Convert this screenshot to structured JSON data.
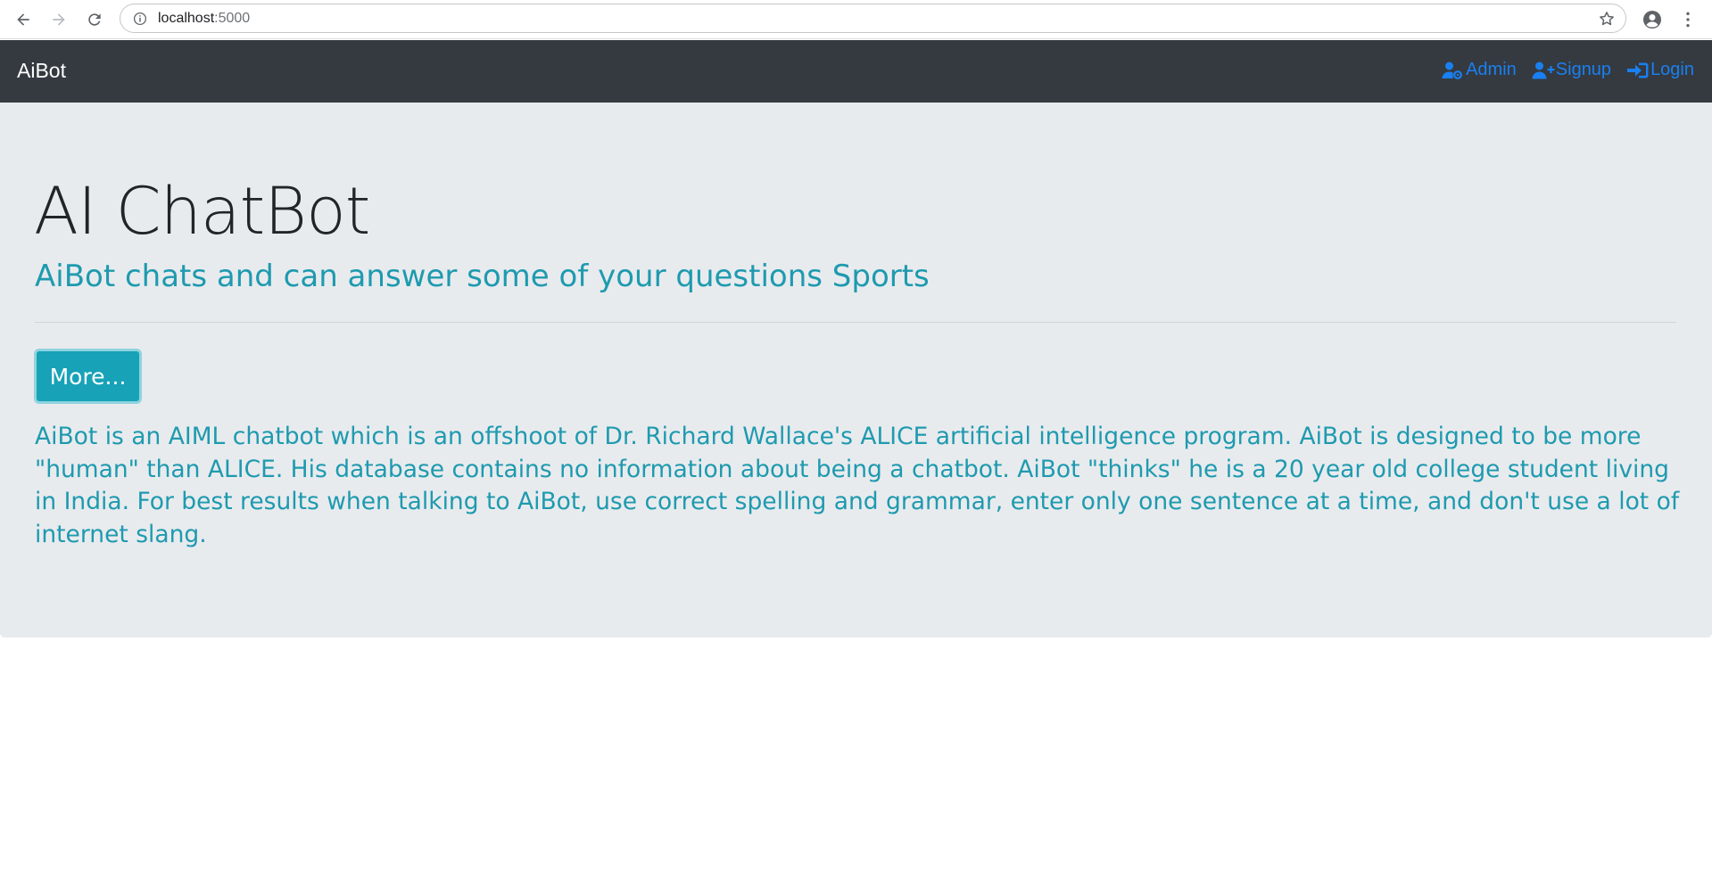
{
  "browser": {
    "url_host": "localhost",
    "url_port": ":5000"
  },
  "navbar": {
    "brand": "AiBot",
    "links": [
      {
        "label": "Admin",
        "icon": "user-cog-icon"
      },
      {
        "label": "Signup",
        "icon": "user-plus-icon"
      },
      {
        "label": "Login",
        "icon": "sign-in-icon"
      }
    ]
  },
  "hero": {
    "title": "AI ChatBot",
    "subtitle": "AiBot chats and can answer some of your questions Sports",
    "button_label": "More...",
    "description": "AiBot is an AIML chatbot which is an offshoot of Dr. Richard Wallace's ALICE artificial intelligence program. AiBot is designed to be more \"human\" than ALICE. His database contains no information about being a chatbot. AiBot \"thinks\" he is a 20 year old college student living in India. For best results when talking to AiBot, use correct spelling and grammar, enter only one sentence at a time, and don't use a lot of internet slang."
  },
  "colors": {
    "navbar_bg": "#343a40",
    "link": "#1a7ff0",
    "accent": "#17a2b8",
    "jumbotron_bg": "#e8ebee"
  }
}
